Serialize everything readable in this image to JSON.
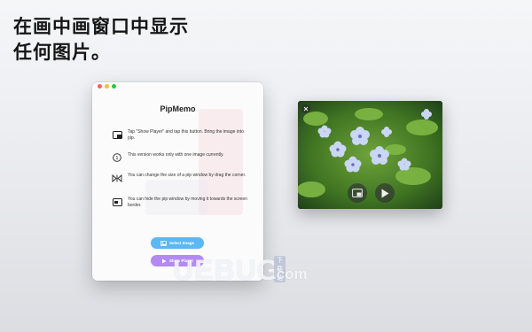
{
  "headline": {
    "line1": "在画中画窗口中显示",
    "line2": "任何图片。"
  },
  "app": {
    "title": "PipMemo",
    "features": [
      {
        "icon": "pip-window-icon",
        "text": "Tap \"Show Player\" and tap this button. Bring the image into pip."
      },
      {
        "icon": "single-image-icon",
        "text": "This version works only with one image currently."
      },
      {
        "icon": "resize-icon",
        "text": "You can change the size of a pip window by drag the corner."
      },
      {
        "icon": "hide-window-icon",
        "text": "You can hide the pip window by moving it towards the screen border."
      }
    ],
    "buttons": {
      "select_image": "Select Image",
      "show_player": "Show Player"
    }
  },
  "watermark": {
    "brand": "UEBUG",
    "domain": ".com",
    "tag": "下载站"
  },
  "colors": {
    "select_button": "#5ab8f3",
    "show_button": "#b38af2",
    "close": "#fe5f57",
    "minimize": "#febc2e",
    "maximize": "#28c840"
  }
}
